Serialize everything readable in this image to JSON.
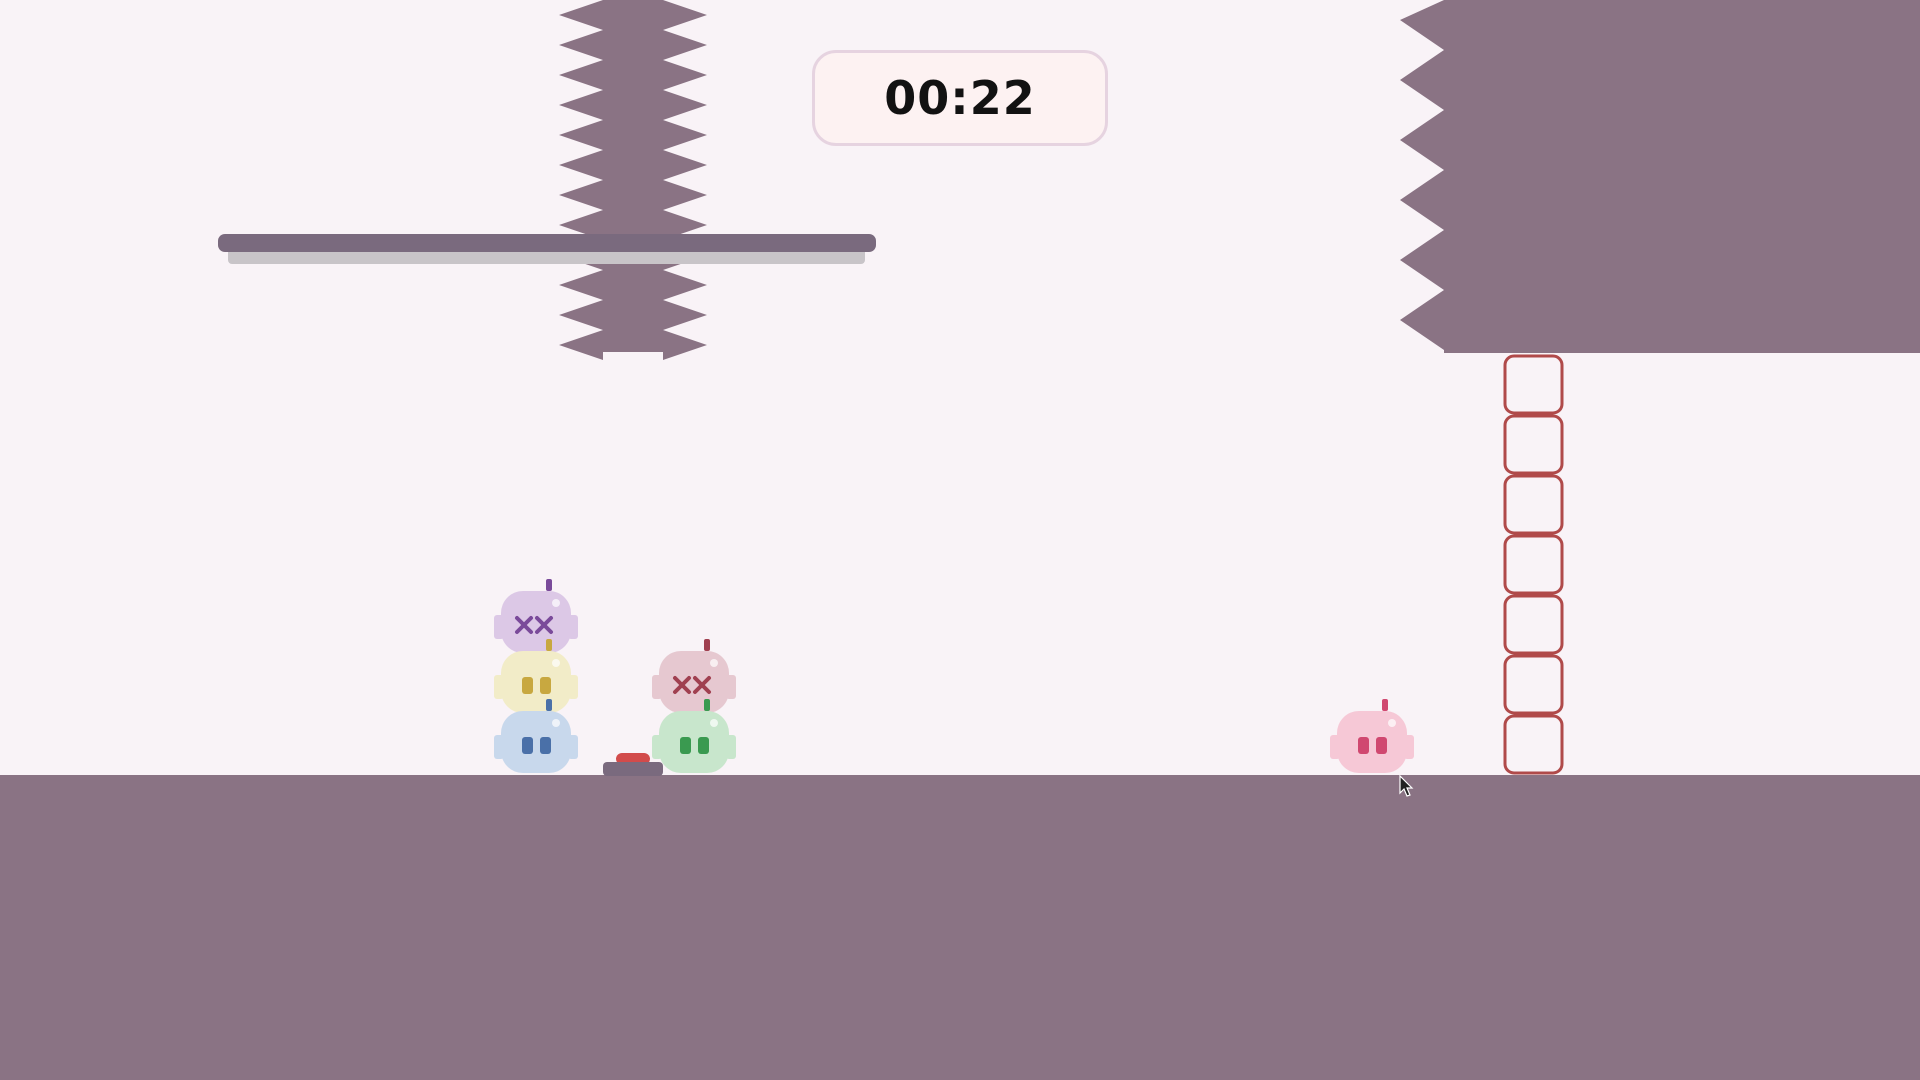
{
  "hud": {
    "timer": "00:22"
  },
  "colors": {
    "background": "#f9f3f7",
    "terrain": "#8a7384",
    "platform": "#7a6a7e",
    "platform_shadow": "#c8c4c8",
    "block_outline": "#b04a4a",
    "button_red": "#d24b4b",
    "button_base": "#7a6a7e"
  },
  "characters": [
    {
      "name": "purple-robot",
      "color": "#dcc8e6",
      "accent": "#7a4a9a",
      "state": "dead"
    },
    {
      "name": "yellow-robot",
      "color": "#f2ecc8",
      "accent": "#c8a840",
      "state": "alive"
    },
    {
      "name": "blue-robot",
      "color": "#c8d8ec",
      "accent": "#4a70a8",
      "state": "alive"
    },
    {
      "name": "rose-robot",
      "color": "#e6c8d0",
      "accent": "#a04050",
      "state": "dead"
    },
    {
      "name": "green-robot",
      "color": "#c8e6cc",
      "accent": "#3a9a50",
      "state": "alive"
    },
    {
      "name": "pink-robot",
      "color": "#f6c8d6",
      "accent": "#d04870",
      "state": "alive"
    }
  ],
  "objects": {
    "spike_pillar": "spike-pillar",
    "spike_wall": "spike-wall",
    "floating_platform": "floating-platform",
    "pressure_button": "pressure-button",
    "outline_blocks": 7
  }
}
